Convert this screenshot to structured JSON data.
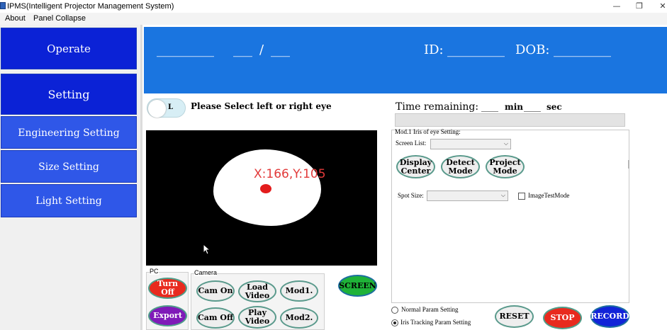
{
  "window": {
    "title": "IPMS(Intelligent Projector Management System)",
    "minimize": "—",
    "maximize": "❐",
    "close": "✕"
  },
  "menu": {
    "items": [
      "About",
      "Panel Collapse"
    ]
  },
  "sidebar": {
    "items": [
      "Operate",
      "Setting",
      "Engineering Setting",
      "Size Setting",
      "Light Setting"
    ]
  },
  "header": {
    "field1": "_________",
    "field2": "___",
    "slash": "/",
    "field3": "___",
    "id_label": "ID:",
    "id_value": "_________",
    "dob_label": "DOB:",
    "dob_value": "_________"
  },
  "eye": {
    "toggle_label": "L",
    "prompt": "Please Select left or right eye"
  },
  "video": {
    "coord_text": "X:166,Y:105"
  },
  "timer": {
    "label": "Time remaining:",
    "min_value": "____",
    "min_unit": "min",
    "sec_value": "____",
    "sec_unit": "sec"
  },
  "mod": {
    "title": "Mod.1 Iris of eye Setting:",
    "screen_list_label": "Screen List:",
    "screen_list_value": "",
    "display_center": "Display\nCenter",
    "detect_mode": "Detect\nMode",
    "project_mode": "Project\nMode",
    "spot_size_label": "Spot Size:",
    "spot_size_value": "",
    "image_test_mode": "ImageTestMode"
  },
  "pc": {
    "title": "PC",
    "turn_off": "Turn Off",
    "export": "Export"
  },
  "camera": {
    "title": "Camera",
    "cam_on": "Cam On",
    "load_video": "Load\nVideo",
    "mod1": "Mod1.",
    "cam_off": "Cam Off",
    "play_video": "Play\nVideo",
    "mod2": "Mod2."
  },
  "screen_button": "SCREEN",
  "params": {
    "normal": "Normal Param Setting",
    "iris": "Iris Tracking Param Setting",
    "selected": "iris"
  },
  "actions": {
    "reset": "RESET",
    "stop": "STOP",
    "record": "RECORD"
  }
}
